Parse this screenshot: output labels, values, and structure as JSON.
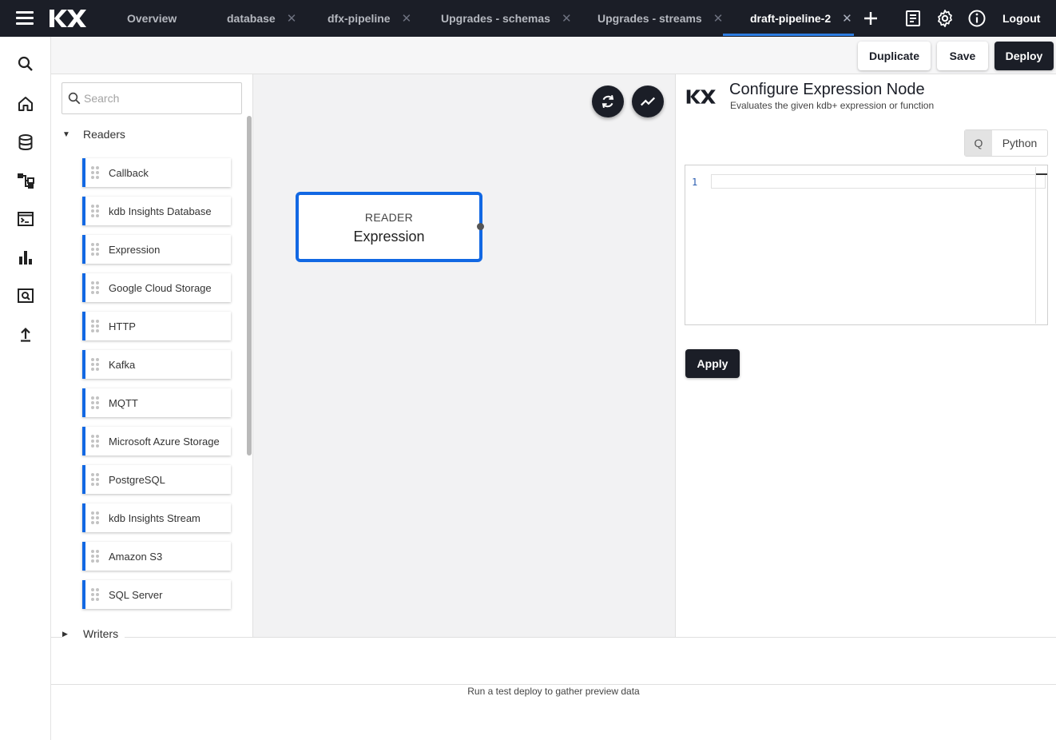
{
  "topbar": {
    "tabs": [
      {
        "label": "Overview",
        "closable": false
      },
      {
        "label": "database",
        "closable": true
      },
      {
        "label": "dfx-pipeline",
        "closable": true
      },
      {
        "label": "Upgrades - schemas",
        "closable": true
      },
      {
        "label": "Upgrades - streams",
        "closable": true
      },
      {
        "label": "draft-pipeline-2",
        "closable": true,
        "active": true
      }
    ],
    "close_glyph": "✕",
    "add_glyph": "+",
    "logout_label": "Logout",
    "icons": [
      "menu-icon",
      "kx-logo",
      "add-tab-icon",
      "notes-icon",
      "gear-icon",
      "info-icon"
    ]
  },
  "rail": {
    "icons": [
      "search-icon",
      "home-icon",
      "database-icon",
      "pipeline-icon",
      "terminal-icon",
      "chart-icon",
      "query-icon",
      "upload-icon"
    ]
  },
  "actions": {
    "duplicate_label": "Duplicate",
    "save_label": "Save",
    "deploy_label": "Deploy"
  },
  "nodes_panel": {
    "search_placeholder": "Search",
    "groups": [
      {
        "name": "Readers",
        "expanded": true,
        "items": [
          "Callback",
          "kdb Insights Database",
          "Expression",
          "Google Cloud Storage",
          "HTTP",
          "Kafka",
          "MQTT",
          "Microsoft Azure Storage",
          "PostgreSQL",
          "kdb Insights Stream",
          "Amazon S3",
          "SQL Server"
        ]
      },
      {
        "name": "Writers",
        "expanded": false,
        "items": []
      }
    ]
  },
  "canvas": {
    "node": {
      "kind": "READER",
      "title": "Expression"
    }
  },
  "config": {
    "title": "Configure Expression Node",
    "subtitle": "Evaluates the given kdb+ expression or function",
    "language_options": [
      "Q",
      "Python"
    ],
    "selected_language": "Q",
    "editor_line_number": "1",
    "apply_label": "Apply"
  },
  "preview": {
    "message": "Run a test deploy to gather preview data"
  },
  "colors": {
    "topbar_bg": "#1b1e27",
    "accent_blue": "#1268e3",
    "canvas_bg": "#f2f2f3"
  }
}
